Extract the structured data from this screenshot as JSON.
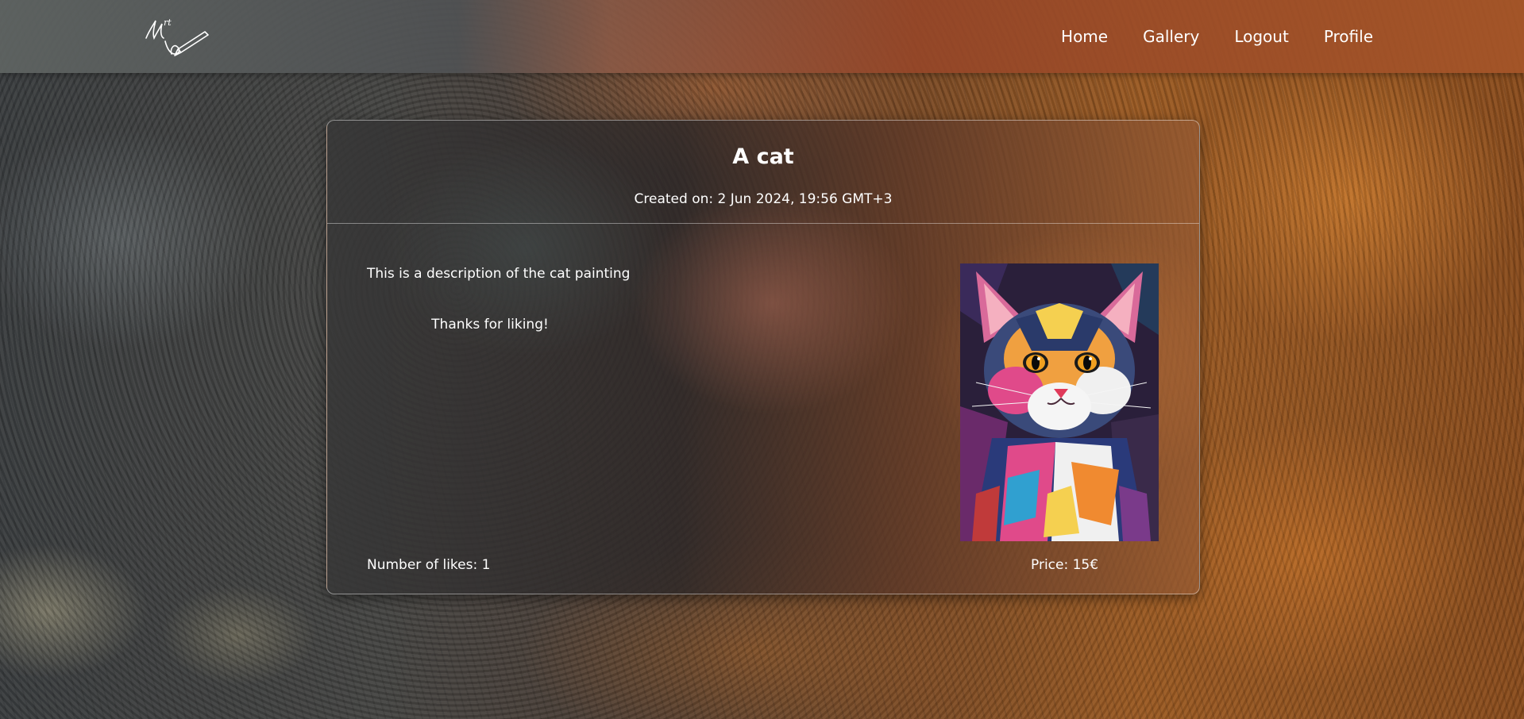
{
  "nav": {
    "logo_alt": "Art",
    "links": [
      "Home",
      "Gallery",
      "Logout",
      "Profile"
    ]
  },
  "artwork": {
    "title": "A cat",
    "created_label": "Created on:",
    "created_value": "2 Jun 2024, 19:56 GMT+3",
    "description": "This is a description of the cat painting",
    "thanks_message": "Thanks for liking!",
    "likes_label": "Number of likes:",
    "likes_value": "1",
    "price_label": "Price:",
    "price_value": "15€",
    "image_alt": "cat painting"
  },
  "colors": {
    "text": "#ffffff",
    "card_border": "#ffffff"
  }
}
